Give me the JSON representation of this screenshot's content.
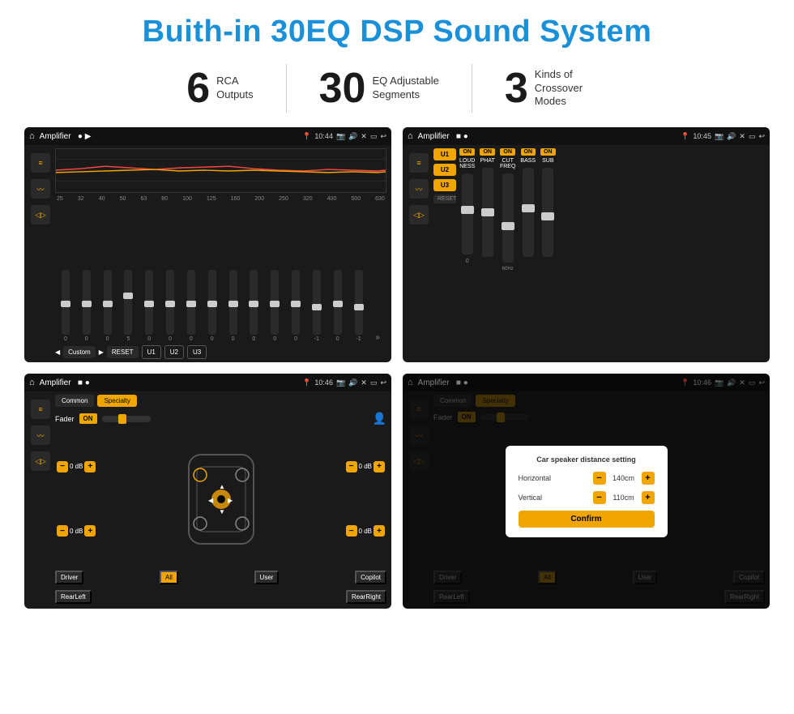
{
  "title": "Buith-in 30EQ DSP Sound System",
  "stats": [
    {
      "number": "6",
      "label": "RCA\nOutputs"
    },
    {
      "number": "30",
      "label": "EQ Adjustable\nSegments"
    },
    {
      "number": "3",
      "label": "Kinds of\nCrossover Modes"
    }
  ],
  "screens": [
    {
      "id": "eq-screen",
      "statusBar": {
        "appTitle": "Amplifier",
        "dots": "● ▶",
        "time": "10:44"
      },
      "type": "eq"
    },
    {
      "id": "amp-screen",
      "statusBar": {
        "appTitle": "Amplifier",
        "dots": "■ ●",
        "time": "10:45"
      },
      "type": "amplifier"
    },
    {
      "id": "fader-screen",
      "statusBar": {
        "appTitle": "Amplifier",
        "dots": "■ ●",
        "time": "10:46"
      },
      "type": "fader"
    },
    {
      "id": "dialog-screen",
      "statusBar": {
        "appTitle": "Amplifier",
        "dots": "■ ●",
        "time": "10:46"
      },
      "type": "dialog",
      "dialog": {
        "title": "Car speaker distance setting",
        "horizontal_label": "Horizontal",
        "horizontal_value": "140cm",
        "vertical_label": "Vertical",
        "vertical_value": "110cm",
        "confirm": "Confirm"
      }
    }
  ],
  "eq": {
    "frequencies": [
      "25",
      "32",
      "40",
      "50",
      "63",
      "80",
      "100",
      "125",
      "160",
      "200",
      "250",
      "320",
      "400",
      "500",
      "630"
    ],
    "values": [
      "0",
      "0",
      "0",
      "5",
      "0",
      "0",
      "0",
      "0",
      "0",
      "0",
      "0",
      "0",
      "-1",
      "0",
      "-1"
    ],
    "preset": "Custom",
    "buttons": [
      "RESET",
      "U1",
      "U2",
      "U3"
    ]
  },
  "amp": {
    "presets": [
      "U1",
      "U2",
      "U3"
    ],
    "channels": [
      {
        "label": "LOUDNESS",
        "on": true,
        "sliderPos": 60
      },
      {
        "label": "PHAT",
        "on": true,
        "sliderPos": 50
      },
      {
        "label": "CUT FREQ",
        "on": true,
        "sliderPos": 40
      },
      {
        "label": "BASS",
        "on": true,
        "sliderPos": 55
      },
      {
        "label": "SUB",
        "on": true,
        "sliderPos": 45
      }
    ],
    "resetLabel": "RESET"
  },
  "fader": {
    "tabs": [
      "Common",
      "Specialty"
    ],
    "activeTab": "Specialty",
    "faderLabel": "Fader",
    "faderOn": "ON",
    "volumes": [
      {
        "label": "0 dB",
        "side": "left"
      },
      {
        "label": "0 dB",
        "side": "left"
      },
      {
        "label": "0 dB",
        "side": "right"
      },
      {
        "label": "0 dB",
        "side": "right"
      }
    ],
    "bottomButtons": [
      "Driver",
      "All",
      "User",
      "RearLeft",
      "RearRight",
      "Copilot"
    ]
  },
  "dialog": {
    "title": "Car speaker distance setting",
    "horizontalLabel": "Horizontal",
    "horizontalValue": "140cm",
    "verticalLabel": "Vertical",
    "verticalValue": "110cm",
    "confirmLabel": "Confirm"
  }
}
